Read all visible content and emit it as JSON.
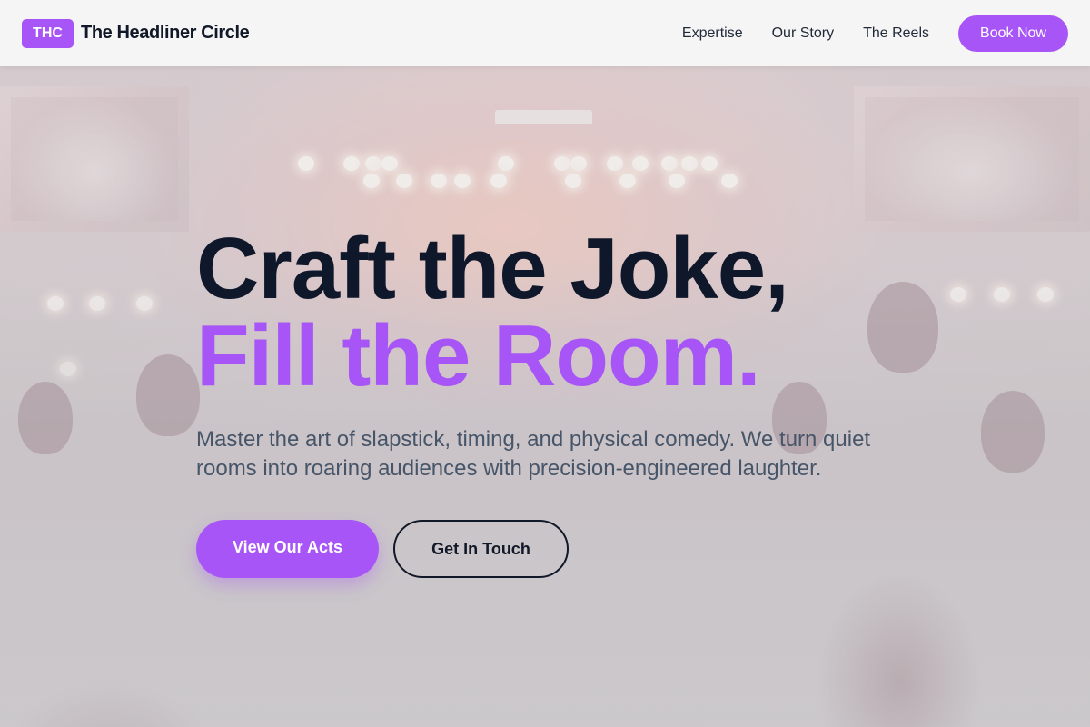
{
  "brand": {
    "badge": "THC",
    "name": "The Headliner Circle"
  },
  "nav": {
    "links": [
      "Expertise",
      "Our Story",
      "The Reels"
    ],
    "cta": "Book Now"
  },
  "hero": {
    "title_line1": "Craft the Joke,",
    "title_line2": "Fill the Room.",
    "subtitle": "Master the art of slapstick, timing, and physical comedy. We turn quiet rooms into roaring audiences with precision-engineered laughter.",
    "primary_button": "View Our Acts",
    "secondary_button": "Get In Touch"
  },
  "colors": {
    "accent": "#a855f7",
    "heading": "#0f172a",
    "body_text": "#475569"
  }
}
